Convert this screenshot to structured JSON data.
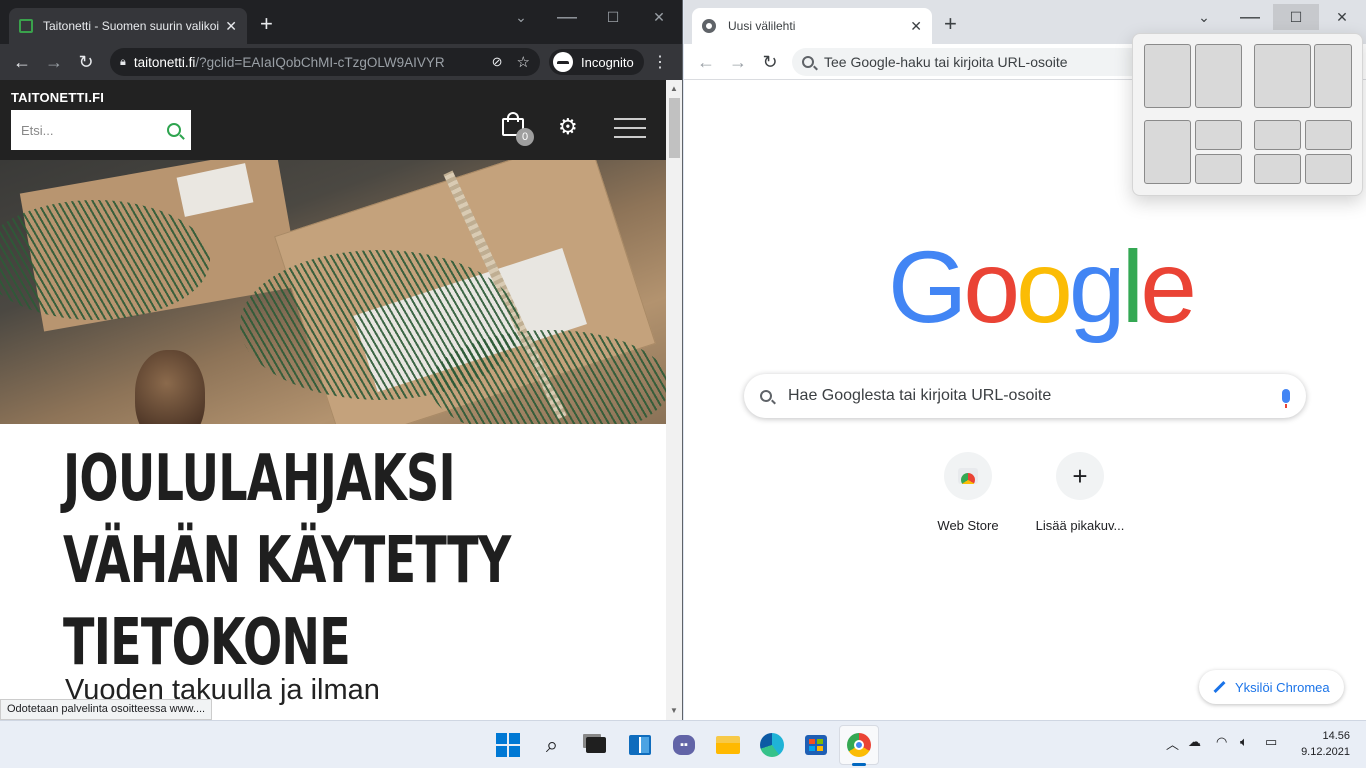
{
  "left_window": {
    "tab_title": "Taitonetti - Suomen suurin valikoima",
    "url_host": "taitonetti.fi",
    "url_rest": "/?gclid=EAIaIQobChMI-cTzgOLW9AIVYR",
    "incognito_label": "Incognito",
    "site": {
      "logo": "TAITONETTI.FI",
      "search_placeholder": "Etsi...",
      "cart_count": "0",
      "headline_lines": [
        "JOULULAHJAKSI",
        "VÄHÄN KÄYTETTY",
        "TIETOKONE"
      ],
      "subline": "Vuoden takuulla ja ilman"
    },
    "status_text": "Odotetaan palvelinta osoitteessa www...."
  },
  "right_window": {
    "tab_title": "Uusi välilehti",
    "omnibox_placeholder": "Tee Google-haku tai kirjoita URL-osoite",
    "logo_letters": [
      "G",
      "o",
      "o",
      "g",
      "l",
      "e"
    ],
    "search_placeholder": "Hae Googlesta tai kirjoita URL-osoite",
    "shortcuts": [
      {
        "label": "Web Store",
        "icon": "webstore-icon"
      },
      {
        "label": "Lisää pikakuv...",
        "icon": "plus-icon"
      }
    ],
    "customize_label": "Yksilöi Chromea"
  },
  "taskbar": {
    "apps": [
      "start",
      "search",
      "task-view",
      "widgets",
      "teams-chat",
      "file-explorer",
      "edge",
      "store",
      "chrome"
    ],
    "active_app": "chrome",
    "time": "14.56",
    "date": "9.12.2021"
  },
  "colors": {
    "google_blue": "#4285f4",
    "google_red": "#ea4335",
    "google_yellow": "#fbbc05",
    "google_green": "#34a853",
    "accent_blue": "#1a73e8"
  }
}
